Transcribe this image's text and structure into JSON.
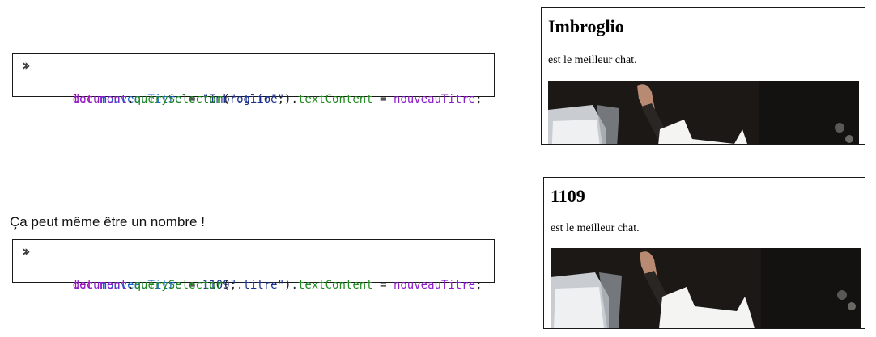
{
  "examples": [
    {
      "console": {
        "prompt_icon": "double-chevron-right-icon",
        "line1": {
          "kw": "let",
          "var": "nouveauTitre",
          "op": "=",
          "value": "\"Imbroglio\"",
          "end": ";"
        },
        "line2": {
          "obj": "document",
          "method": "querySelector",
          "arg": "\".titre\"",
          "prop": "textContent",
          "op": "=",
          "rhs": "nouveauTitre",
          "end": ";"
        }
      },
      "page": {
        "title": "Imbroglio",
        "subtitle": "est le meilleur chat.",
        "image": "cat-photo"
      }
    },
    {
      "caption": "Ça peut même être un nombre !",
      "console": {
        "prompt_icon": "double-chevron-right-icon",
        "line1": {
          "kw": "let",
          "var": "nouveauTitre",
          "op": "=",
          "value": "1109",
          "end": ";"
        },
        "line2": {
          "obj": "document",
          "method": "querySelector",
          "arg": "\".titre\"",
          "prop": "textContent",
          "op": "=",
          "rhs": "nouveauTitre",
          "end": ";"
        }
      },
      "page": {
        "title": "1109",
        "subtitle": "est le meilleur chat.",
        "image": "cat-photo"
      }
    }
  ]
}
